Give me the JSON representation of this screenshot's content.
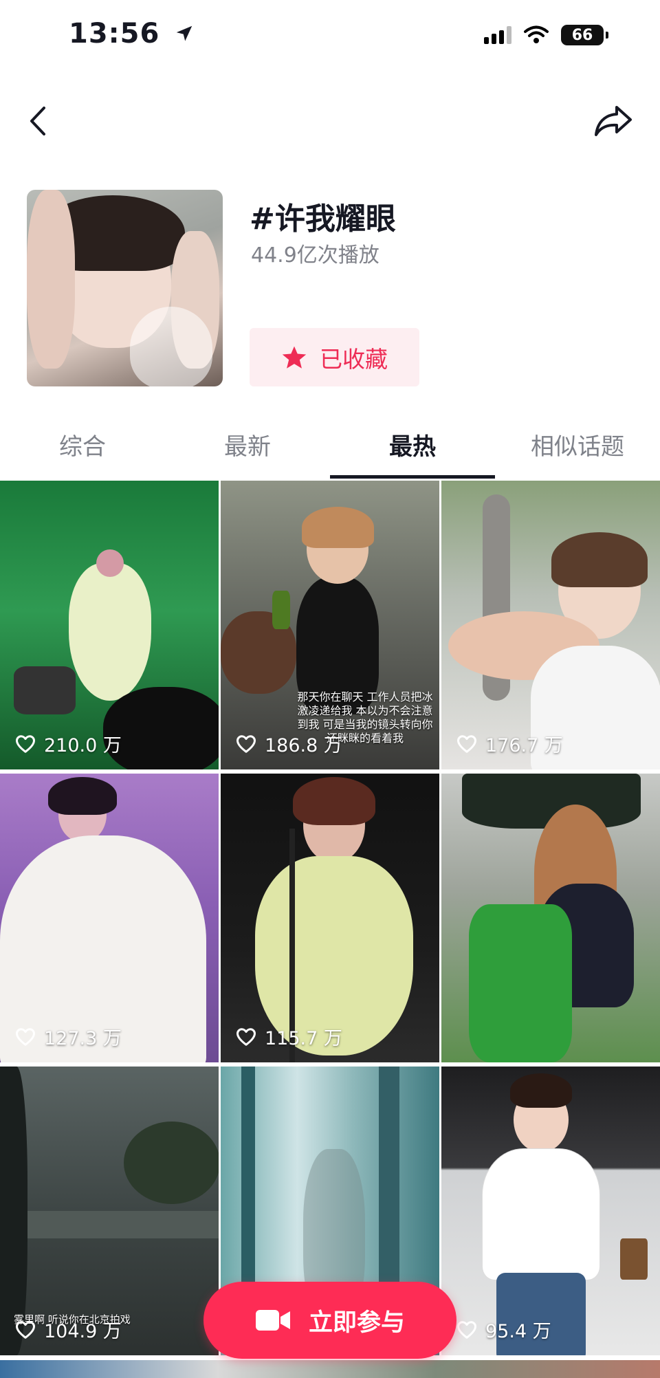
{
  "status_bar": {
    "time": "13:56",
    "battery": "66"
  },
  "topic": {
    "title": "#许我耀眼",
    "plays": "44.9亿次播放",
    "collect_label": "已收藏"
  },
  "tabs": [
    {
      "label": "综合",
      "active": false
    },
    {
      "label": "最新",
      "active": false
    },
    {
      "label": "最热",
      "active": true
    },
    {
      "label": "相似话题",
      "active": false
    }
  ],
  "videos": [
    {
      "likes": "210.0 万"
    },
    {
      "likes": "186.8 万",
      "caption": "那天你在聊天 工作人员把冰激凌递给我 本以为不会注意到我 可是当我的镜头转向你 还眯眯的看着我"
    },
    {
      "likes": "176.7 万"
    },
    {
      "likes": "127.3 万"
    },
    {
      "likes": "115.7 万"
    },
    {
      "likes": ""
    },
    {
      "likes": "104.9 万",
      "caption": "雾里啊 听说你在北京拍戏"
    },
    {
      "likes": ""
    },
    {
      "likes": "95.4 万"
    }
  ],
  "join_button": {
    "label": "立即参与"
  },
  "colors": {
    "accent": "#fe2c55",
    "collect_bg": "#fdeef1",
    "collect_text": "#ee2c55"
  },
  "icons": {
    "back": "chevron-left-icon",
    "share": "share-arrow-icon",
    "collect": "star-icon",
    "like": "heart-outline-icon",
    "join": "video-camera-icon"
  }
}
